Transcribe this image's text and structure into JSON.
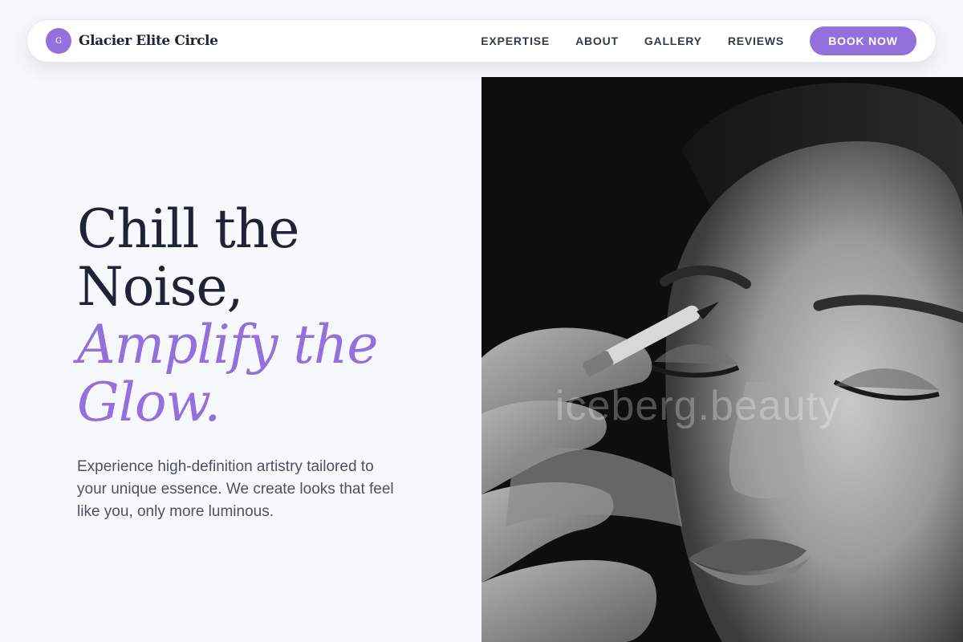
{
  "brand": {
    "mark": "G",
    "name": "Glacier Elite Circle"
  },
  "nav": {
    "links": [
      "EXPERTISE",
      "ABOUT",
      "GALLERY",
      "REVIEWS"
    ],
    "cta": "BOOK NOW"
  },
  "hero": {
    "headline_line1": "Chill the",
    "headline_line2": "Noise,",
    "accent_line1": "Amplify the",
    "accent_line2": "Glow.",
    "lead": "Experience high-definition artistry tailored to your unique essence. We create looks that feel like you, only more luminous.",
    "image_watermark": "iceberg.beauty"
  },
  "colors": {
    "accent": "#9370db",
    "heading": "#1e2436",
    "body_text": "#4b5263",
    "background": "#f7f8fc"
  },
  "icons": {
    "brand_mark": "monogram-circle-icon"
  }
}
